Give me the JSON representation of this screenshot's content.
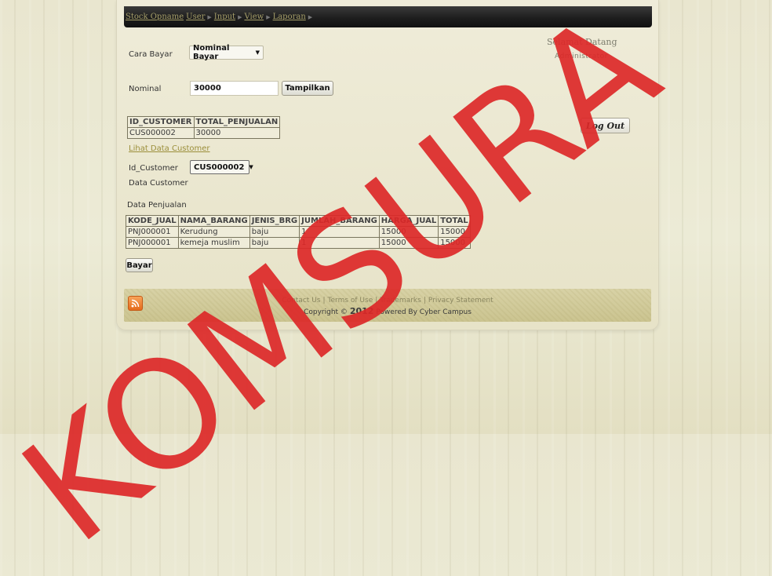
{
  "nav": {
    "items": [
      "Stock Opname",
      "User",
      "Input",
      "View",
      "Laporan"
    ]
  },
  "form": {
    "cara_bayar_label": "Cara Bayar",
    "cara_bayar_value": "Nominal Bayar",
    "nominal_label": "Nominal",
    "nominal_value": "30000",
    "tampilkan_label": "Tampilkan",
    "id_customer_label": "Id_Customer",
    "id_customer_value": "CUS000002",
    "data_customer_label": "Data Customer",
    "data_penjualan_label": "Data Penjualan",
    "bayar_label": "Bayar"
  },
  "sidebar": {
    "welcome": "Selamat Datang",
    "user": "Administrator",
    "logout_label": "Log Out"
  },
  "summary_table": {
    "headers": [
      "ID_CUSTOMER",
      "TOTAL_PENJUALAN"
    ],
    "rows": [
      [
        "CUS000002",
        "30000"
      ]
    ]
  },
  "lihat_link": "Lihat Data Customer",
  "sales_table": {
    "headers": [
      "KODE_JUAL",
      "NAMA_BARANG",
      "JENIS_BRG",
      "JUMLAH_BARANG",
      "HARGA_JUAL",
      "TOTAL"
    ],
    "rows": [
      [
        "PNJ000001",
        "Kerudung",
        "baju",
        "1",
        "15000",
        "15000"
      ],
      [
        "PNJ000001",
        "kemeja muslim",
        "baju",
        "1",
        "15000",
        "15000"
      ]
    ]
  },
  "footer": {
    "links": [
      "Contact Us",
      "Terms of Use",
      "Trademarks",
      "Privacy Statement"
    ],
    "copyright_prefix": "Copyright ©",
    "year": "2012",
    "copyright_suffix": "Powered By Cyber Campus"
  },
  "watermark": {
    "text": "KOMSURA",
    "color": "#dc2828"
  }
}
